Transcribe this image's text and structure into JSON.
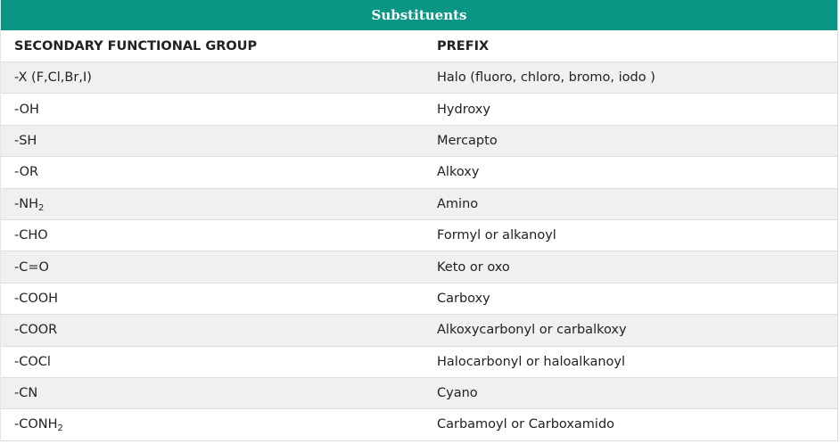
{
  "table": {
    "title": "Substituents",
    "headers": {
      "group": "SECONDARY FUNCTIONAL GROUP",
      "prefix": "PREFIX"
    },
    "rows": [
      {
        "group": "-X (F,Cl,Br,I)",
        "group_sub": "",
        "prefix": "Halo (fluoro, chloro, bromo, iodo )"
      },
      {
        "group": "-OH",
        "group_sub": "",
        "prefix": "Hydroxy"
      },
      {
        "group": "-SH",
        "group_sub": "",
        "prefix": "Mercapto"
      },
      {
        "group": "-OR",
        "group_sub": "",
        "prefix": "Alkoxy"
      },
      {
        "group": "-NH",
        "group_sub": "2",
        "prefix": "Amino"
      },
      {
        "group": "-CHO",
        "group_sub": "",
        "prefix": "Formyl or alkanoyl"
      },
      {
        "group": "-C=O",
        "group_sub": "",
        "prefix": "Keto or oxo"
      },
      {
        "group": "-COOH",
        "group_sub": "",
        "prefix": "Carboxy"
      },
      {
        "group": "-COOR",
        "group_sub": "",
        "prefix": "Alkoxycarbonyl or carbalkoxy"
      },
      {
        "group": "-COCl",
        "group_sub": "",
        "prefix": "Halocarbonyl or haloalkanoyl"
      },
      {
        "group": "-CN",
        "group_sub": "",
        "prefix": "Cyano"
      },
      {
        "group": "-CONH",
        "group_sub": "2",
        "prefix": "Carbamoyl or Carboxamido"
      }
    ]
  },
  "colors": {
    "title_bar": "#0a9584",
    "stripe": "#f0f0f0"
  }
}
